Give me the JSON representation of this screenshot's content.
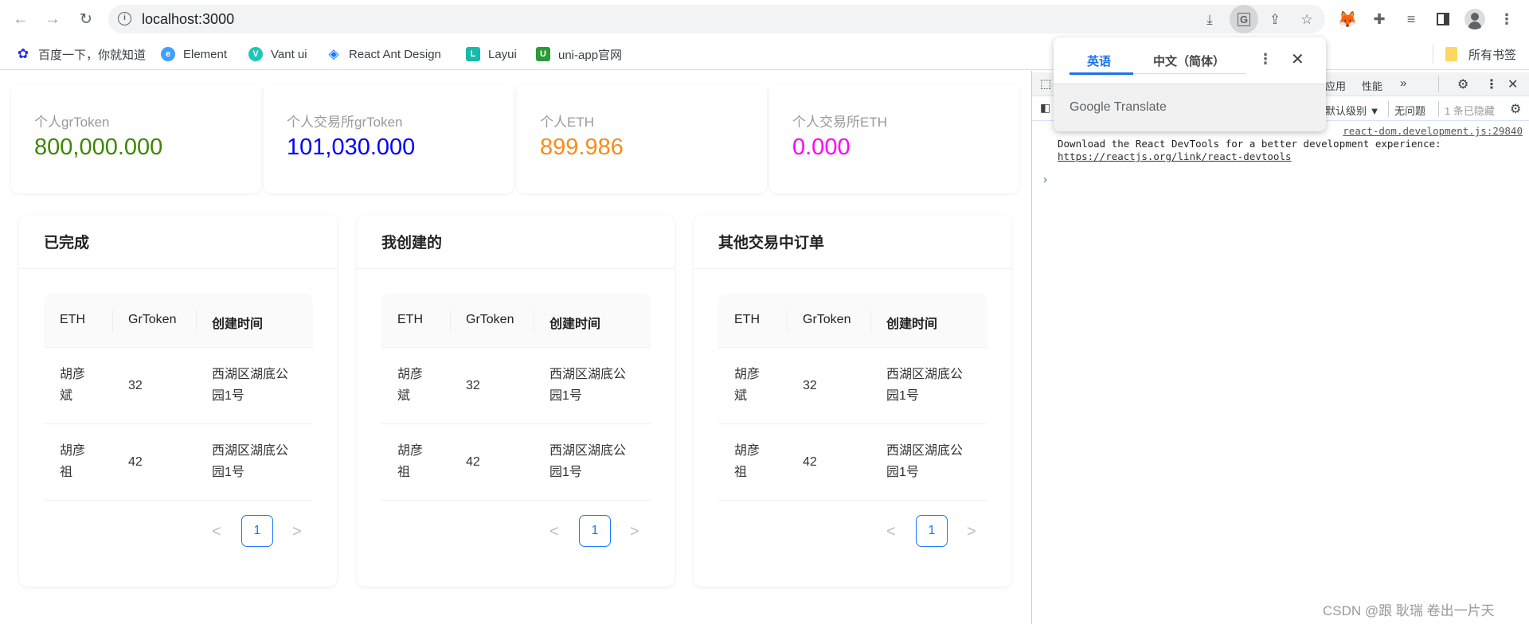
{
  "browser": {
    "url": "localhost:3000",
    "nav": {
      "back": "←",
      "forward": "→",
      "reload": "↻"
    },
    "omnibox_icons": [
      "install-icon",
      "translate-icon",
      "share-icon",
      "bookmark-star-icon"
    ],
    "toolbar_icons": [
      "metamask-extension-icon",
      "extensions-icon",
      "reading-list-icon",
      "side-panel-icon",
      "profile-avatar",
      "menu-icon"
    ]
  },
  "bookmarks": [
    {
      "label": "百度一下，你就知道",
      "icon": "baidu-icon",
      "color": "#2932e1",
      "glyph": "✿"
    },
    {
      "label": "Element",
      "icon": "element-icon",
      "color": "#409eff",
      "glyph": "e"
    },
    {
      "label": "Vant ui",
      "icon": "vant-icon",
      "color": "#07c160",
      "glyph": "V"
    },
    {
      "label": "React Ant Design",
      "icon": "ant-design-icon",
      "color": "#1677ff",
      "glyph": "◇"
    },
    {
      "label": "Layui",
      "icon": "layui-icon",
      "color": "#16baaa",
      "glyph": "L"
    },
    {
      "label": "uni-app官网",
      "icon": "uniapp-icon",
      "color": "#2b9939",
      "glyph": "U"
    }
  ],
  "all_bookmarks": "所有书签",
  "stats": [
    {
      "label": "个人grToken",
      "value": "800,000.000",
      "color": "#3f8600"
    },
    {
      "label": "个人交易所grToken",
      "value": "101,030.000",
      "color": "#0000ff"
    },
    {
      "label": "个人ETH",
      "value": "899.986",
      "color": "#fa8c16"
    },
    {
      "label": "个人交易所ETH",
      "value": "0.000",
      "color": "#ff00ff"
    }
  ],
  "tables": [
    {
      "title": "已完成",
      "columns": [
        "ETH",
        "GrToken",
        "创建时间"
      ],
      "rows": [
        {
          "eth": "胡彦\n斌",
          "grtoken": "32",
          "time": "西湖区湖底公\n园1号"
        },
        {
          "eth": "胡彦\n祖",
          "grtoken": "42",
          "time": "西湖区湖底公\n园1号"
        }
      ],
      "pagination": {
        "prev": "<",
        "current": "1",
        "next": ">"
      }
    },
    {
      "title": "我创建的",
      "columns": [
        "ETH",
        "GrToken",
        "创建时间"
      ],
      "rows": [
        {
          "eth": "胡彦\n斌",
          "grtoken": "32",
          "time": "西湖区湖底公\n园1号"
        },
        {
          "eth": "胡彦\n祖",
          "grtoken": "42",
          "time": "西湖区湖底公\n园1号"
        }
      ],
      "pagination": {
        "prev": "<",
        "current": "1",
        "next": ">"
      }
    },
    {
      "title": "其他交易中订单",
      "columns": [
        "ETH",
        "GrToken",
        "创建时间"
      ],
      "rows": [
        {
          "eth": "胡彦\n斌",
          "grtoken": "32",
          "time": "西湖区湖底公\n园1号"
        },
        {
          "eth": "胡彦\n祖",
          "grtoken": "42",
          "time": "西湖区湖底公\n园1号"
        }
      ],
      "pagination": {
        "prev": "<",
        "current": "1",
        "next": ">"
      }
    }
  ],
  "devtools": {
    "tabs_visible": [
      "应用",
      "性能"
    ],
    "more_tabs": "»",
    "level_filter": "默认级别 ▼",
    "issues": "无问题",
    "hidden_count": "1 条已隐藏",
    "console": {
      "source": "react-dom.development.js:29840",
      "message": "Download the React DevTools for a better development experience: ",
      "link": "https://reactjs.org/link/react-devtools",
      "prompt": "›"
    }
  },
  "translate_popup": {
    "source_lang": "英语",
    "target_lang": "中文（简体）",
    "brand": "Google Translate"
  },
  "watermark": "CSDN @跟 耿瑞 卷出一片天"
}
